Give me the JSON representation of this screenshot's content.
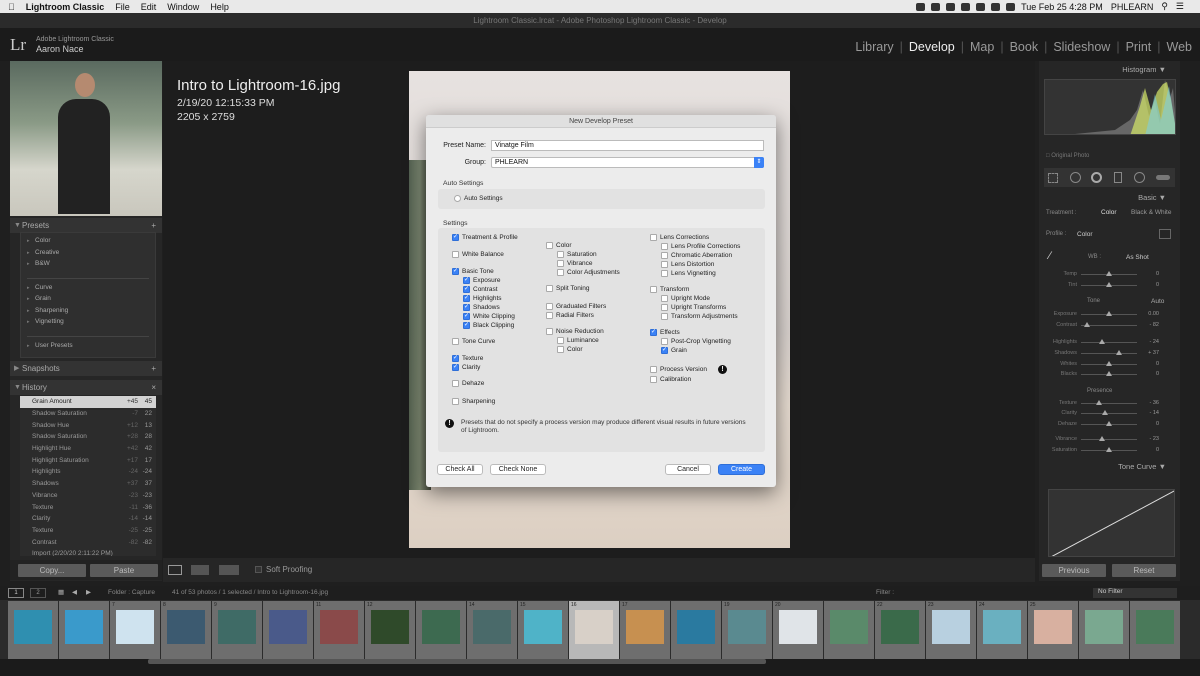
{
  "menubar": {
    "app": "Lightroom Classic",
    "items": [
      "File",
      "Edit",
      "Window",
      "Help"
    ],
    "datetime": "Tue Feb 25  4:28 PM",
    "user": "PHLEARN"
  },
  "window_title": "Lightroom Classic.lrcat - Adobe Photoshop Lightroom Classic - Develop",
  "identity": {
    "logo": "Lr",
    "product": "Adobe Lightroom Classic",
    "name": "Aaron Nace"
  },
  "modules": [
    "Library",
    "Develop",
    "Map",
    "Book",
    "Slideshow",
    "Print",
    "Web"
  ],
  "active_module": "Develop",
  "left_panel": {
    "presets_header": "Presets",
    "presets": [
      "Color",
      "Creative",
      "B&W",
      "Curve",
      "Grain",
      "Sharpening",
      "Vignetting",
      "User Presets"
    ],
    "snapshots_header": "Snapshots",
    "history_header": "History",
    "history": [
      {
        "name": "Grain Amount",
        "a": "+45",
        "b": "45",
        "selected": true
      },
      {
        "name": "Shadow Saturation",
        "a": "-7",
        "b": "22"
      },
      {
        "name": "Shadow Hue",
        "a": "+12",
        "b": "13"
      },
      {
        "name": "Shadow Saturation",
        "a": "+28",
        "b": "28"
      },
      {
        "name": "Highlight Hue",
        "a": "+42",
        "b": "42"
      },
      {
        "name": "Highlight Saturation",
        "a": "+17",
        "b": "17"
      },
      {
        "name": "Highlights",
        "a": "-24",
        "b": "-24"
      },
      {
        "name": "Shadows",
        "a": "+37",
        "b": "37"
      },
      {
        "name": "Vibrance",
        "a": "-23",
        "b": "-23"
      },
      {
        "name": "Texture",
        "a": "-11",
        "b": "-36"
      },
      {
        "name": "Clarity",
        "a": "-14",
        "b": "-14"
      },
      {
        "name": "Texture",
        "a": "-25",
        "b": "-25"
      },
      {
        "name": "Contrast",
        "a": "-82",
        "b": "-82"
      },
      {
        "name": "Import (2/20/20 2:11:22 PM)",
        "a": "",
        "b": ""
      }
    ],
    "copy_label": "Copy...",
    "paste_label": "Paste"
  },
  "photo_info": {
    "filename": "Intro to Lightroom-16.jpg",
    "datetime": "2/19/20 12:15:33 PM",
    "dimensions": "2205 x 2759"
  },
  "dialog": {
    "title": "New Develop Preset",
    "preset_name_label": "Preset Name:",
    "preset_name_value": "Vinatge Film",
    "group_label": "Group:",
    "group_value": "PHLEARN",
    "auto_header": "Auto Settings",
    "auto_item": "Auto Settings",
    "settings_header": "Settings",
    "col1": [
      {
        "label": "Treatment & Profile",
        "checked": true,
        "indent": 0
      },
      {
        "label": "White Balance",
        "checked": false,
        "indent": 0
      },
      {
        "label": "Basic Tone",
        "checked": true,
        "indent": 0
      },
      {
        "label": "Exposure",
        "checked": true,
        "indent": 1
      },
      {
        "label": "Contrast",
        "checked": true,
        "indent": 1
      },
      {
        "label": "Highlights",
        "checked": true,
        "indent": 1
      },
      {
        "label": "Shadows",
        "checked": true,
        "indent": 1
      },
      {
        "label": "White Clipping",
        "checked": true,
        "indent": 1
      },
      {
        "label": "Black Clipping",
        "checked": true,
        "indent": 1
      },
      {
        "label": "Tone Curve",
        "checked": false,
        "indent": 0
      },
      {
        "label": "Texture",
        "checked": true,
        "indent": 0
      },
      {
        "label": "Clarity",
        "checked": true,
        "indent": 0
      },
      {
        "label": "Dehaze",
        "checked": false,
        "indent": 0
      },
      {
        "label": "Sharpening",
        "checked": false,
        "indent": 0
      }
    ],
    "col2": [
      {
        "label": "Color",
        "checked": false,
        "indent": 0
      },
      {
        "label": "Saturation",
        "checked": false,
        "indent": 1
      },
      {
        "label": "Vibrance",
        "checked": false,
        "indent": 1
      },
      {
        "label": "Color Adjustments",
        "checked": false,
        "indent": 1
      },
      {
        "label": "Split Toning",
        "checked": false,
        "indent": 0
      },
      {
        "label": "Graduated Filters",
        "checked": false,
        "indent": 0
      },
      {
        "label": "Radial Filters",
        "checked": false,
        "indent": 0
      },
      {
        "label": "Noise Reduction",
        "checked": false,
        "indent": 0
      },
      {
        "label": "Luminance",
        "checked": false,
        "indent": 1
      },
      {
        "label": "Color",
        "checked": false,
        "indent": 1
      }
    ],
    "col3": [
      {
        "label": "Lens Corrections",
        "checked": false,
        "indent": 0
      },
      {
        "label": "Lens Profile Corrections",
        "checked": false,
        "indent": 1
      },
      {
        "label": "Chromatic Aberration",
        "checked": false,
        "indent": 1
      },
      {
        "label": "Lens Distortion",
        "checked": false,
        "indent": 1
      },
      {
        "label": "Lens Vignetting",
        "checked": false,
        "indent": 1
      },
      {
        "label": "Transform",
        "checked": false,
        "indent": 0
      },
      {
        "label": "Upright Mode",
        "checked": false,
        "indent": 1
      },
      {
        "label": "Upright Transforms",
        "checked": false,
        "indent": 1
      },
      {
        "label": "Transform Adjustments",
        "checked": false,
        "indent": 1
      },
      {
        "label": "Effects",
        "checked": true,
        "indent": 0
      },
      {
        "label": "Post-Crop Vignetting",
        "checked": false,
        "indent": 1
      },
      {
        "label": "Grain",
        "checked": true,
        "indent": 1
      },
      {
        "label": "Process Version",
        "checked": false,
        "indent": 0
      },
      {
        "label": "Calibration",
        "checked": false,
        "indent": 0
      }
    ],
    "warning": "Presets that do not specify a process version may produce different visual results in future versions of Lightroom.",
    "check_all": "Check All",
    "check_none": "Check None",
    "cancel": "Cancel",
    "create": "Create"
  },
  "toolbar": {
    "soft_proofing": "Soft Proofing"
  },
  "right_panel": {
    "histogram_header": "Histogram",
    "original_photo": "Original Photo",
    "basic_header": "Basic",
    "treatment_label": "Treatment :",
    "treatment_color": "Color",
    "treatment_bw": "Black & White",
    "profile_label": "Profile :",
    "profile_value": "Color",
    "wb_label": "WB :",
    "wb_value": "As Shot",
    "tone_label": "Tone",
    "tone_auto": "Auto",
    "presence_label": "Presence",
    "sliders": [
      {
        "label": "Temp",
        "value": "0",
        "pos": 0.5
      },
      {
        "label": "Tint",
        "value": "0",
        "pos": 0.5
      },
      {
        "label": "Exposure",
        "value": "0.00",
        "pos": 0.5
      },
      {
        "label": "Contrast",
        "value": "- 82",
        "pos": 0.1
      },
      {
        "label": "Highlights",
        "value": "- 24",
        "pos": 0.38
      },
      {
        "label": "Shadows",
        "value": "+ 37",
        "pos": 0.68
      },
      {
        "label": "Whites",
        "value": "0",
        "pos": 0.5
      },
      {
        "label": "Blacks",
        "value": "0",
        "pos": 0.5
      },
      {
        "label": "Texture",
        "value": "- 36",
        "pos": 0.32
      },
      {
        "label": "Clarity",
        "value": "- 14",
        "pos": 0.43
      },
      {
        "label": "Dehaze",
        "value": "0",
        "pos": 0.5
      },
      {
        "label": "Vibrance",
        "value": "- 23",
        "pos": 0.38
      },
      {
        "label": "Saturation",
        "value": "0",
        "pos": 0.5
      }
    ],
    "tone_curve_header": "Tone Curve",
    "previous": "Previous",
    "reset": "Reset"
  },
  "filmstrip": {
    "folder": "Folder : Capture",
    "count": "41 of 53 photos / 1 selected / Intro to Lightroom-16.jpg",
    "filter_label": "Filter :",
    "filter_value": "No Filter",
    "page1": "1",
    "page2": "2",
    "frames": [
      {
        "num": "",
        "color": "#2f8fb0",
        "sel": false
      },
      {
        "num": "",
        "color": "#3a9acb",
        "sel": false
      },
      {
        "num": "7",
        "color": "#cfe3ef",
        "sel": false
      },
      {
        "num": "8",
        "color": "#3c5a70",
        "sel": false
      },
      {
        "num": "9",
        "color": "#3f6b66",
        "sel": false
      },
      {
        "num": "",
        "color": "#4a5a8a",
        "sel": false
      },
      {
        "num": "11",
        "color": "#8a4a4a",
        "sel": false
      },
      {
        "num": "12",
        "color": "#2f4a2a",
        "sel": false
      },
      {
        "num": "",
        "color": "#3d6a50",
        "sel": false
      },
      {
        "num": "14",
        "color": "#4a6a6a",
        "sel": false
      },
      {
        "num": "15",
        "color": "#4fb3c8",
        "sel": false
      },
      {
        "num": "16",
        "color": "#d8d0c8",
        "sel": true
      },
      {
        "num": "17",
        "color": "#c79050",
        "sel": false
      },
      {
        "num": "",
        "color": "#2a7aa0",
        "sel": false
      },
      {
        "num": "19",
        "color": "#5a8a90",
        "sel": false
      },
      {
        "num": "20",
        "color": "#e0e4e8",
        "sel": false
      },
      {
        "num": "",
        "color": "#5a8a6a",
        "sel": false
      },
      {
        "num": "22",
        "color": "#3a6a4a",
        "sel": false
      },
      {
        "num": "23",
        "color": "#b8d0e0",
        "sel": false
      },
      {
        "num": "24",
        "color": "#6ab0c0",
        "sel": false
      },
      {
        "num": "25",
        "color": "#d8b0a0",
        "sel": false
      },
      {
        "num": "",
        "color": "#7aa890",
        "sel": false
      },
      {
        "num": "",
        "color": "#4a7a5a",
        "sel": false
      }
    ]
  }
}
